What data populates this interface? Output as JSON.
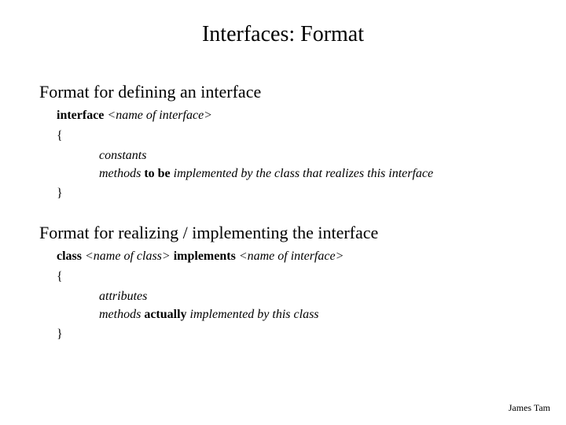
{
  "title": "Interfaces: Format",
  "sec1": {
    "heading": "Format for defining an interface",
    "sig_kw": "interface ",
    "sig_param": "<name of interface>",
    "open": "{",
    "line1": "constants",
    "line2_pre": "methods ",
    "line2_bold": "to be",
    "line2_post": " implemented by the class that realizes this interface",
    "close": "}"
  },
  "sec2": {
    "heading": "Format for realizing / implementing the interface",
    "sig_kw1": "class ",
    "sig_param1": "<name of class>",
    "sig_kw2": " implements ",
    "sig_param2": "<name of interface>",
    "open": "{",
    "line1": "attributes",
    "line2_pre": "methods ",
    "line2_bold": "actually",
    "line2_post": " implemented by this class",
    "close": "}"
  },
  "footer": "James Tam"
}
